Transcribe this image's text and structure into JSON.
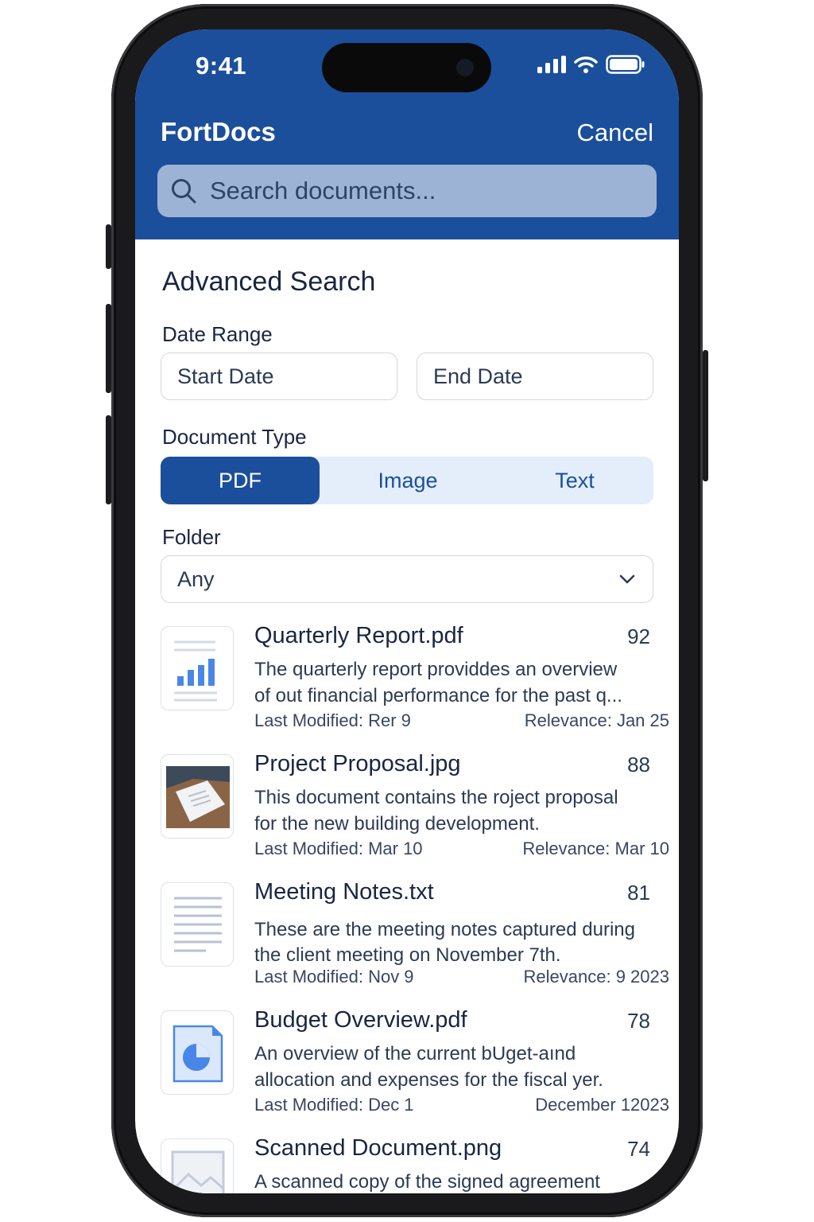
{
  "status": {
    "time": "9:41"
  },
  "app": {
    "title": "FortDocs",
    "cancel_label": "Cancel"
  },
  "search": {
    "placeholder": "Search documents..."
  },
  "advanced": {
    "title": "Advanced Search",
    "date_range": {
      "label": "Date Range",
      "start_placeholder": "Start Date",
      "end_placeholder": "End Date"
    },
    "document_type": {
      "label": "Document Type",
      "options": [
        "PDF",
        "Image",
        "Text"
      ],
      "selected": "PDF"
    },
    "folder": {
      "label": "Folder",
      "value": "Any"
    }
  },
  "colors": {
    "brand": "#1b4f9b",
    "search_bg": "#9db3d6",
    "segment_bg": "#e3eefa"
  },
  "results": [
    {
      "title": "Quarterly Report.pdf",
      "score": "92",
      "desc_line1": "The quarterly report providdes an overview",
      "desc_line2": "of out financial performance for the past q...",
      "modified": "Last Modified: Rer 9",
      "relevance": "Relevance: Jan 25",
      "icon": "bar-chart-icon"
    },
    {
      "title": "Project Proposal.jpg",
      "score": "88",
      "desc_line1": "This document contains the roject proposal",
      "desc_line2": "for the new building development.",
      "modified": "Last Modified: Mar 10",
      "relevance": "Relevance: Mar 10",
      "icon": "photo-thumbnail"
    },
    {
      "title": "Meeting Notes.txt",
      "score": "81",
      "desc_line1": "These are the meeting notes captured during",
      "desc_line2": "the client meeting on November 7th.",
      "modified": "Last Modified: Nov 9",
      "relevance": "Relevance: 9 2023",
      "icon": "text-lines-icon"
    },
    {
      "title": "Budget Overview.pdf",
      "score": "78",
      "desc_line1": "An overview of the current bUget-aınd",
      "desc_line2": "allocation and expenses for the fiscal yer.",
      "modified": "Last Modified: Dec 1",
      "relevance": "December 12023",
      "icon": "pie-chart-icon"
    },
    {
      "title": "Scanned Document.png",
      "score": "74",
      "desc_line1": "A scanned copy of the signed agreement",
      "icon": "image-placeholder-icon"
    }
  ]
}
